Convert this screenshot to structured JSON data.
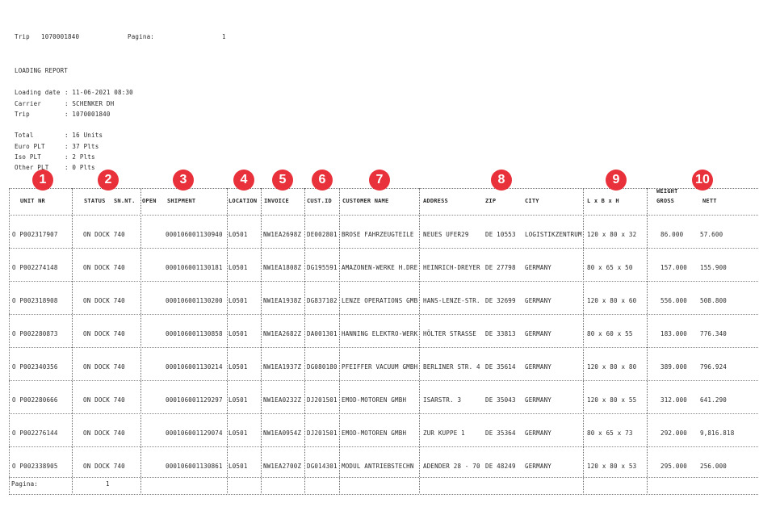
{
  "header": {
    "trip_label": "Trip",
    "trip_value": "1070001840",
    "pagina_label": "Pagina:",
    "pagina_value": "1",
    "report_title": "LOADING REPORT",
    "fields": [
      {
        "label": "Loading date",
        "value": ": 11-06-2021 08:30"
      },
      {
        "label": "Carrier",
        "value": ": SCHENKER DH"
      },
      {
        "label": "Trip",
        "value": ": 1070001840"
      }
    ],
    "totals": [
      {
        "label": "Total",
        "value": ": 16 Units"
      },
      {
        "label": "Euro PLT",
        "value": ": 37 Plts"
      },
      {
        "label": "Iso PLT",
        "value": ": 2 Plts"
      },
      {
        "label": "Other PLT",
        "value": ": 0 Plts"
      }
    ]
  },
  "badges": [
    "1",
    "2",
    "3",
    "4",
    "5",
    "6",
    "7",
    "8",
    "9",
    "10"
  ],
  "columns": {
    "unit_nr": "UNIT NR",
    "status": "STATUS",
    "sn_nt": "SN.NT.",
    "open": "OPEN",
    "shipment": "SHIPMENT",
    "location": "LOCATION",
    "invoice": "INVOICE",
    "cust_id": "CUST.ID",
    "customer_name": "CUSTOMER NAME",
    "address": "ADDRESS",
    "zip": "ZIP",
    "city": "CITY",
    "dims": "L x  B x  H",
    "weight": "WEIGHT",
    "gross": "GROSS",
    "nett": "NETT"
  },
  "rows": [
    {
      "unit": "O P002317907",
      "status": "ON DOCK 740",
      "shipment": "000106001130940",
      "location": "L0501",
      "invoice": "NW1EA2698Z",
      "cust": "DE002801",
      "customer": "BROSE FAHRZEUGTEILE",
      "address": "NEUES UFER29",
      "zip": "DE 10553",
      "city": "LOGISTIKZENTRUM",
      "dims": "120 x  80 x 32",
      "gross": "86.000",
      "nett": "57.600"
    },
    {
      "unit": "O P002274148",
      "status": "ON DOCK 740",
      "shipment": "000106001130181",
      "location": "L0501",
      "invoice": "NW1EA1808Z",
      "cust": "DG195591",
      "customer": "AMAZONEN-WERKE H.DRE",
      "address": "HEINRICH-DREYER",
      "zip": "DE 27798",
      "city": "GERMANY",
      "dims": "80 x  65 x 50",
      "gross": "157.000",
      "nett": "155.900"
    },
    {
      "unit": "O P002318908",
      "status": "ON DOCK 740",
      "shipment": "000106001130200",
      "location": "L0501",
      "invoice": "NW1EA1938Z",
      "cust": "DG837102",
      "customer": "LENZE OPERATIONS GMB",
      "address": "HANS-LENZE-STR.",
      "zip": "DE 32699",
      "city": "GERMANY",
      "dims": "120 x  80 x 60",
      "gross": "556.000",
      "nett": "508.800"
    },
    {
      "unit": "O P002280873",
      "status": "ON DOCK 740",
      "shipment": "000106001130858",
      "location": "L0501",
      "invoice": "NW1EA2682Z",
      "cust": "DA001301",
      "customer": "HANNING ELEKTRO-WERK",
      "address": "HÖLTER STRASSE",
      "zip": "DE 33813",
      "city": "GERMANY",
      "dims": "80 x  60 x 55",
      "gross": "183.000",
      "nett": "776.340"
    },
    {
      "unit": "O P002340356",
      "status": "ON DOCK 740",
      "shipment": "000106001130214",
      "location": "L0501",
      "invoice": "NW1EA1937Z",
      "cust": "DG080180",
      "customer": "PFEIFFER VACUUM GMBH",
      "address": "BERLINER STR. 4",
      "zip": "DE 35614",
      "city": "GERMANY",
      "dims": "120 x  80 x 80",
      "gross": "389.000",
      "nett": "796.924"
    },
    {
      "unit": "O P002280666",
      "status": "ON DOCK 740",
      "shipment": "000106001129297",
      "location": "L0501",
      "invoice": "NW1EA0232Z",
      "cust": "DJ201501",
      "customer": "EMOD-MOTOREN GMBH",
      "address": "ISARSTR. 3",
      "zip": "DE 35043",
      "city": "GERMANY",
      "dims": "120 x  80 x 55",
      "gross": "312.000",
      "nett": "641.290"
    },
    {
      "unit": "O P002276144",
      "status": "ON DOCK 740",
      "shipment": "000106001129074",
      "location": "L0501",
      "invoice": "NW1EA0954Z",
      "cust": "DJ201501",
      "customer": "EMOD-MOTOREN GMBH",
      "address": "ZUR KUPPE 1",
      "zip": "DE 35364",
      "city": "GERMANY",
      "dims": "80 x  65 x 73",
      "gross": "292.000",
      "nett": "9,816.818"
    },
    {
      "unit": "O P002338905",
      "status": "ON DOCK 740",
      "shipment": "000106001130861",
      "location": "L0501",
      "invoice": "NW1EA2700Z",
      "cust": "DG014301",
      "customer": "MODUL ANTRIEBSTECHN",
      "address": "ADENDER 28 - 70",
      "zip": "DE 48249",
      "city": "GERMANY",
      "dims": "120 x  80 x 53",
      "gross": "295.000",
      "nett": "256.000"
    }
  ],
  "footer": {
    "pagina_label": "Pagina:",
    "pagina_value": "1"
  }
}
